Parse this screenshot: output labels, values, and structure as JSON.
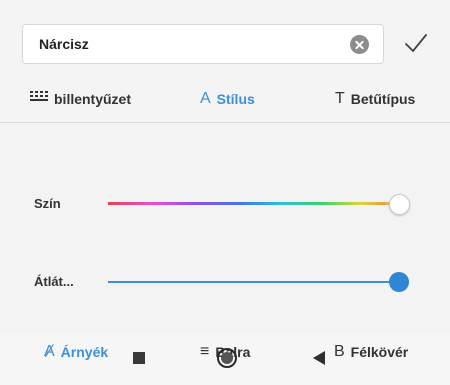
{
  "name_field": {
    "value": "Nárcisz"
  },
  "tabs": [
    {
      "glyph": "⌨",
      "label": "billentyűzet",
      "active": false
    },
    {
      "glyph": "A",
      "label": "Stílus",
      "active": true
    },
    {
      "glyph": "T",
      "label": "Betűtípus",
      "active": false
    }
  ],
  "sliders": {
    "color": {
      "label": "Szín",
      "value_fraction": 1.0
    },
    "opacity": {
      "label": "Átlát...",
      "value_fraction": 1.0
    }
  },
  "bottom_tabs": [
    {
      "glyph": "Ⱥ",
      "label": "Árnyék",
      "active": true
    },
    {
      "glyph": "≡",
      "label": "Balra",
      "active": false
    },
    {
      "glyph": "B",
      "label": "Félkövér",
      "active": false
    }
  ],
  "colors": {
    "accent": "#3d8fd6",
    "slider_blue": "#2f86d3"
  },
  "icons": {
    "clear": "clear-circle-icon",
    "confirm": "checkmark-icon",
    "nav_recent": "square-icon",
    "nav_home": "circle-icon",
    "nav_back": "triangle-back-icon"
  }
}
